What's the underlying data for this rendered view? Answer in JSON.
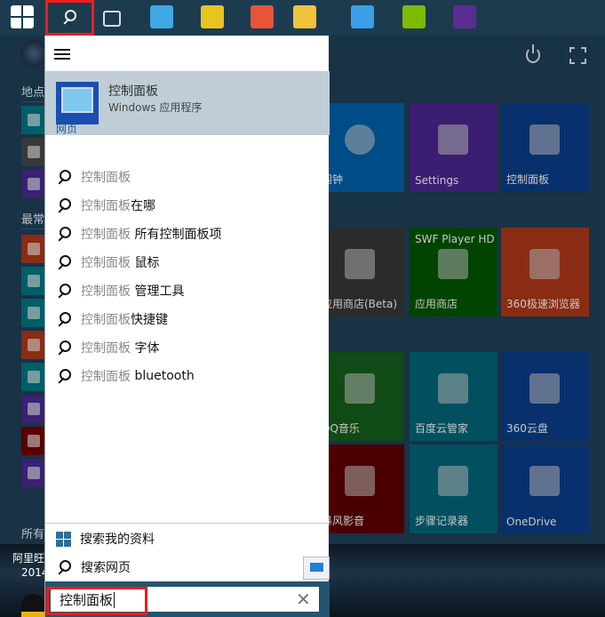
{
  "taskbar": {
    "icons": [
      {
        "name": "start-windows-icon",
        "color": "#ffffff"
      },
      {
        "name": "search-icon",
        "color": "#ffffff",
        "selected": true
      },
      {
        "name": "task-view-icon",
        "color": "#e0e0e0"
      },
      {
        "name": "baidu-cloud-icon",
        "color": "#3fa9e5"
      },
      {
        "name": "qq-music-icon",
        "color": "#e8c420"
      },
      {
        "name": "360-browser-icon",
        "color": "#e8533a"
      },
      {
        "name": "file-explorer-icon",
        "color": "#f2c33e"
      },
      {
        "name": "xunlei-icon",
        "color": "#3a9ee8"
      },
      {
        "name": "microsoft-store-icon",
        "color": "#7fba00"
      },
      {
        "name": "settings-icon",
        "color": "#5c2d91"
      }
    ]
  },
  "sidebar": {
    "places_label": "地点",
    "most_used_label": "最常",
    "all_apps_label": "所有",
    "places": [
      {
        "icon": "file-explorer-icon",
        "color": "#005e68"
      },
      {
        "icon": "documents-icon",
        "color": "#383838"
      },
      {
        "icon": "settings-icon",
        "color": "#3b2171"
      }
    ],
    "most_used": [
      {
        "icon": "360-browser-icon",
        "color": "#8a2c14"
      },
      {
        "icon": "notepad-icon",
        "color": "#005e68"
      },
      {
        "icon": "file-explorer-icon",
        "color": "#005e68"
      },
      {
        "icon": "qq-icon",
        "color": "#8a2c14"
      },
      {
        "icon": "steps-recorder-icon",
        "color": "#005e68"
      },
      {
        "icon": "settings-icon",
        "color": "#3b2171"
      },
      {
        "icon": "baofeng-icon",
        "color": "#5a0000"
      },
      {
        "icon": "search-icon",
        "color": "#3b2171"
      }
    ]
  },
  "tiles": [
    {
      "label": "闹钟",
      "icon": "alarm-clock-icon",
      "color": "#004c87"
    },
    {
      "label": "Settings",
      "icon": "settings-gear-icon",
      "color": "#3b1e72"
    },
    {
      "label": "控制面板",
      "icon": "control-panel-icon",
      "color": "#08306c"
    },
    {
      "label": "应用商店(Beta)",
      "icon": "store-icon",
      "color": "#2b2b2b"
    },
    {
      "label": "应用商店",
      "top": "SWF Player HD",
      "icon": "store-icon",
      "color": "#004400"
    },
    {
      "label": "360极速浏览器",
      "icon": "360-browser-icon",
      "color": "#8a2c14"
    },
    {
      "label": "QQ音乐",
      "icon": "qq-music-icon",
      "color": "#104a14"
    },
    {
      "label": "百度云管家",
      "icon": "baidu-cloud-icon",
      "color": "#005060"
    },
    {
      "label": "360云盘",
      "icon": "360-cloud-icon",
      "color": "#08306c"
    },
    {
      "label": "暴风影音",
      "icon": "baofeng-icon",
      "color": "#4a0000"
    },
    {
      "label": "步骤记录器",
      "icon": "steps-recorder-icon",
      "color": "#005060"
    },
    {
      "label": "OneDrive",
      "icon": "onedrive-icon",
      "color": "#08306c"
    }
  ],
  "search": {
    "best_match": {
      "title": "控制面板",
      "subtitle": "Windows 应用程序"
    },
    "web_header": "网页",
    "suggestions": [
      {
        "query": "控制面板",
        "suffix": ""
      },
      {
        "query": "控制面板",
        "suffix": "在哪"
      },
      {
        "query": "控制面板",
        "suffix": " 所有控制面板项"
      },
      {
        "query": "控制面板",
        "suffix": " 鼠标"
      },
      {
        "query": "控制面板",
        "suffix": " 管理工具"
      },
      {
        "query": "控制面板",
        "suffix": "快捷键"
      },
      {
        "query": "控制面板",
        "suffix": " 字体"
      },
      {
        "query": "控制面板",
        "suffix": " bluetooth"
      }
    ],
    "search_my_stuff": "搜索我的资料",
    "search_web": "搜索网页",
    "input_value": "控制面板"
  },
  "desktop": {
    "icon_label": "阿里旺",
    "icon_label2": "2014"
  },
  "highlight_color": "#f01c1c"
}
